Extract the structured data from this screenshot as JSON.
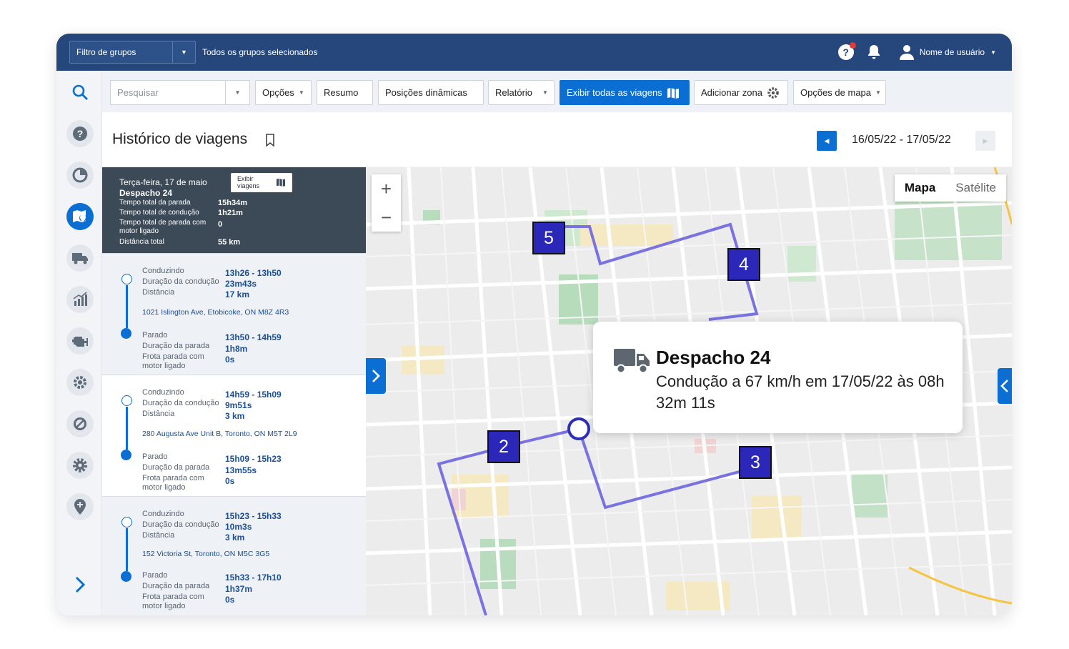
{
  "topbar": {
    "group_filter_label": "Filtro de grupos",
    "group_selection": "Todos os grupos selecionados",
    "user_name": "Nome de usuário",
    "help_icon": "help-icon",
    "notification_icon": "bell-icon",
    "user_icon": "user-icon"
  },
  "sidebar": {
    "items": [
      "search-icon",
      "help-icon",
      "chart-pie-icon",
      "map-pin-icon",
      "truck-icon",
      "bar-chart-icon",
      "engine-icon",
      "gear-cog-icon",
      "blocked-icon",
      "settings-icon",
      "location-pin-icon",
      "expand-chevron-icon"
    ]
  },
  "toolbar": {
    "search_placeholder": "Pesquisar",
    "options_label": "Opções",
    "summary_label": "Resumo",
    "dynamic_positions_label": "Posições dinâmicas",
    "report_label": "Relatório",
    "show_all_trips_label": "Exibir todas as viagens",
    "add_zone_label": "Adicionar zona",
    "map_options_label": "Opções de mapa"
  },
  "page": {
    "title": "Histórico de viagens",
    "date_range": "16/05/22 - 17/05/22"
  },
  "summary": {
    "day": "Terça-feira, 17 de maio",
    "vehicle": "Despacho 24",
    "show_trips_label": "Exibir viagens",
    "rows": [
      {
        "label": "Tempo total da parada",
        "value": "15h34m"
      },
      {
        "label": "Tempo total de condução",
        "value": "1h21m"
      },
      {
        "label": "Tempo total de parada com motor ligado",
        "value": "0"
      },
      {
        "label": "Distância total",
        "value": "55 km"
      }
    ]
  },
  "labels": {
    "driving": "Conduzindo",
    "drive_duration": "Duração da condução",
    "distance": "Distância",
    "stopped": "Parado",
    "stop_duration": "Duração da parada",
    "idle": "Frota parada com motor ligado"
  },
  "trips": [
    {
      "drive_time": "13h26 - 13h50",
      "drive_duration": "23m43s",
      "distance": "17 km",
      "address": "1021 Islington Ave, Etobicoke, ON M8Z 4R3",
      "stop_time": "13h50 - 14h59",
      "stop_duration": "1h8m",
      "idle": "0s"
    },
    {
      "drive_time": "14h59 - 15h09",
      "drive_duration": "9m51s",
      "distance": "3 km",
      "address": "280 Augusta Ave Unit B, Toronto, ON M5T 2L9",
      "stop_time": "15h09 - 15h23",
      "stop_duration": "13m55s",
      "idle": "0s"
    },
    {
      "drive_time": "15h23 - 15h33",
      "drive_duration": "10m3s",
      "distance": "3 km",
      "address": "152 Victoria St, Toronto, ON M5C 3G5",
      "stop_time": "15h33 - 17h10",
      "stop_duration": "1h37m",
      "idle": "0s"
    }
  ],
  "map": {
    "type_map": "Mapa",
    "type_satellite": "Satélite",
    "zoom_in": "+",
    "zoom_out": "−",
    "markers": [
      "2",
      "3",
      "4",
      "5"
    ],
    "route_color": "#7a72e0",
    "marker_color": "#2b27b8",
    "popup": {
      "title": "Despacho 24",
      "description": "Condução a 67 km/h em 17/05/22 às 08h 32m 11s"
    }
  },
  "colors": {
    "topbar": "#25477b",
    "primary": "#0b6ed2",
    "summary_bg": "#3c4a58",
    "value_text": "#1b4f94"
  }
}
